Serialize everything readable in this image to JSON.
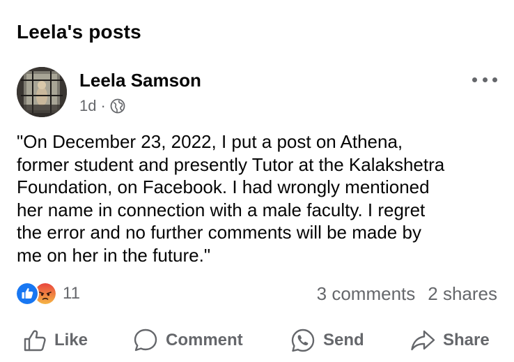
{
  "page": {
    "heading": "Leela's posts"
  },
  "post": {
    "author": "Leela Samson",
    "time": "1d",
    "separator": "·",
    "audience_icon": "globe-icon",
    "more_icon": "more-options-icon",
    "text_lines": [
      "\"On December 23, 2022, I put a post on Athena,",
      "former student and presently Tutor at the Kalakshetra",
      "Foundation, on Facebook. I had wrongly mentioned",
      "her name in connection with a male faculty. I regret",
      "the error and no further comments will be made by",
      "me on her in the future.\""
    ],
    "reactions": {
      "icons": [
        "like-reaction-icon",
        "angry-reaction-icon"
      ],
      "count": "11"
    },
    "comments": "3 comments",
    "shares": "2 shares"
  },
  "actions": {
    "like": "Like",
    "comment": "Comment",
    "send": "Send",
    "share": "Share"
  },
  "colors": {
    "text": "#050505",
    "secondary": "#65676b",
    "like_blue": "#1877f2",
    "angry_orange": "#f0743e"
  }
}
